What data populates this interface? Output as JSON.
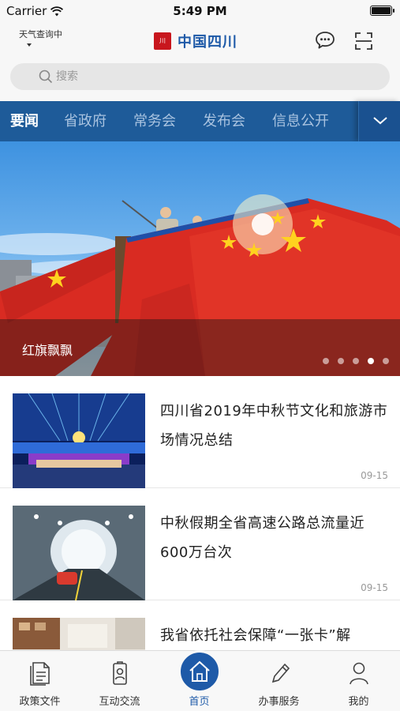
{
  "status_bar": {
    "carrier": "Carrier",
    "time": "5:49 PM"
  },
  "header": {
    "weather": "天气查询中",
    "brand_seal": "中国四川",
    "brand_name": "中国四川",
    "brand_color": "#1e5aa8"
  },
  "search": {
    "placeholder": "搜索"
  },
  "tabs": [
    {
      "label": "要闻",
      "active": true
    },
    {
      "label": "省政府",
      "active": false
    },
    {
      "label": "常务会",
      "active": false
    },
    {
      "label": "发布会",
      "active": false
    },
    {
      "label": "信息公开",
      "active": false
    }
  ],
  "banner": {
    "caption": "红旗飘飘",
    "dots_total": 5,
    "active_dot": 4
  },
  "news": [
    {
      "title": "四川省2019年中秋节文化和旅游市场情况总结",
      "date": "09-15",
      "thumb": "stage-performance"
    },
    {
      "title": "中秋假期全省高速公路总流量近600万台次",
      "date": "09-15",
      "thumb": "highway-tunnel"
    },
    {
      "title": "我省依托社会保障“一张卡”解",
      "date": "",
      "thumb": "office"
    }
  ],
  "tabbar": [
    {
      "label": "政策文件",
      "icon": "document-icon",
      "active": false
    },
    {
      "label": "互动交流",
      "icon": "badge-icon",
      "active": false
    },
    {
      "label": "首页",
      "icon": "home-icon",
      "active": true
    },
    {
      "label": "办事服务",
      "icon": "pen-icon",
      "active": false
    },
    {
      "label": "我的",
      "icon": "person-icon",
      "active": false
    }
  ],
  "colors": {
    "tab_bar_bg": "#1e5b99",
    "accent": "#1e5aa8",
    "flag_red": "#d92b22"
  }
}
